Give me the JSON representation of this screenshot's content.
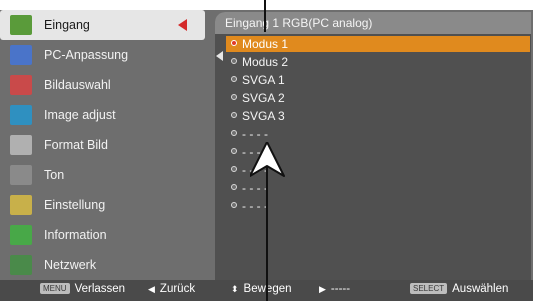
{
  "sidebar": {
    "items": [
      {
        "label": "Eingang",
        "icon": "input-plug-icon",
        "color": "#5a9b3a"
      },
      {
        "label": "PC-Anpassung",
        "icon": "pc-monitor-icon",
        "color": "#4a74c9"
      },
      {
        "label": "Bildauswahl",
        "icon": "image-select-icon",
        "color": "#c94a4a"
      },
      {
        "label": "Image adjust",
        "icon": "image-adjust-icon",
        "color": "#2f90c0"
      },
      {
        "label": "Format Bild",
        "icon": "screen-format-icon",
        "color": "#b0b0b0"
      },
      {
        "label": "Ton",
        "icon": "speaker-icon",
        "color": "#8a8a8a"
      },
      {
        "label": "Einstellung",
        "icon": "settings-icon",
        "color": "#c8b04a"
      },
      {
        "label": "Information",
        "icon": "info-icon",
        "color": "#48a848"
      },
      {
        "label": "Netzwerk",
        "icon": "network-icon",
        "color": "#4a8a4a"
      }
    ],
    "active_index": 0
  },
  "submenu": {
    "title": "Eingang 1 RGB(PC analog)",
    "options": [
      "Modus 1",
      "Modus 2",
      "SVGA 1",
      "SVGA 2",
      "SVGA 3",
      "- - - -",
      "- - - -",
      "- - - -",
      "- - - -",
      "- - - -"
    ],
    "selected_index": 0
  },
  "bottom_bar": {
    "exit": {
      "key": "MENU",
      "label": "Verlassen"
    },
    "back": {
      "label": "Zurück"
    },
    "move": {
      "label": "Bewegen"
    },
    "next": {
      "label": "-----"
    },
    "select": {
      "key": "SELECT",
      "label": "Auswählen"
    }
  },
  "colors": {
    "selection": "#e08a1e",
    "active_arrow": "#d42a2a",
    "background": "#6e6e6e"
  }
}
